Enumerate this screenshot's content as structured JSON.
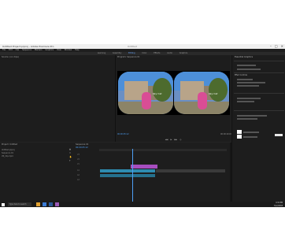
{
  "window_title": "Untitled Project.prproj - Adobe Premiere Pro",
  "center_title": "Untitled",
  "menu": [
    "File",
    "Edit",
    "Clip",
    "Sequence",
    "Markers",
    "Graphics",
    "View",
    "Window",
    "Help"
  ],
  "workspaces": [
    "Learning",
    "Assembly",
    "Editing",
    "Color",
    "Effects",
    "Audio",
    "Graphics"
  ],
  "active_workspace": "Editing",
  "source_tab": "Source: (no clips)",
  "program_tab": "Program: Sequence 01",
  "program_timecode": "00:00:05:12",
  "program_duration": "00:00:20:00",
  "overlay_text": "Sky Cat",
  "essential_graphics_tab": "Essential Graphics",
  "effect_controls_tab": "Effect Controls",
  "project_tab": "Project: Untitled",
  "project_items": [
    "Untitled.prproj",
    "Sequence 01",
    "VR_Clip.mp4"
  ],
  "timeline_tab": "Sequence 01",
  "timeline_timecode": "00:00:05:12",
  "tracks": [
    "V3",
    "V2",
    "V1",
    "A1",
    "A2",
    "A3"
  ],
  "taskbar_search": "Type here to search",
  "clock_time": "4:32 PM",
  "clock_date": "7/12/2018",
  "colors": {
    "accent": "#4d9ff5",
    "video_clip": "#a64dbf",
    "audio_clip": "#2e8cb0"
  }
}
